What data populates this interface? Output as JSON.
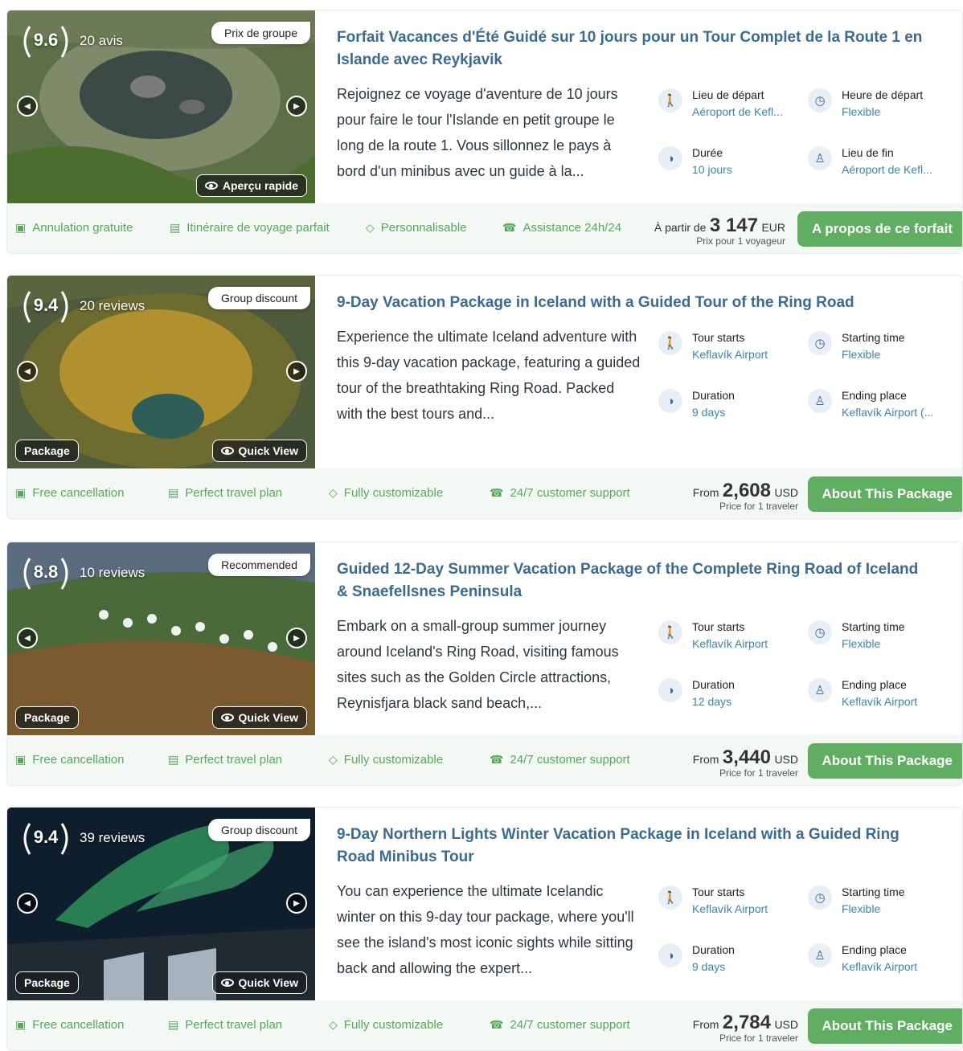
{
  "cards": [
    {
      "score": "9.6",
      "reviews": "20 avis",
      "badge": "Prix de groupe",
      "package_chip": "",
      "quickview": "Aperçu rapide",
      "title": "Forfait Vacances d'Été Guidé sur 10 jours pour un Tour Complet de la Route 1 en Islande avec Reykjavik",
      "description": "Rejoignez ce voyage d'aventure de 10 jours pour faire le tour l'Islande en petit groupe le long de la route 1. Vous sillonnez le pays à bord d'un minibus avec un guide à la...",
      "start_label": "Lieu de départ",
      "start_value": "Aéroport de Kefl...",
      "time_label": "Heure de départ",
      "time_value": "Flexible",
      "duration_label": "Durée",
      "duration_value": "10 jours",
      "end_label": "Lieu de fin",
      "end_value": "Aéroport de Kefl...",
      "features": [
        "Annulation gratuite",
        "Itinéraire de voyage parfait",
        "Personnalisable",
        "Assistance 24h/24"
      ],
      "price_from": "À partir de",
      "price": "3 147",
      "currency": "EUR",
      "price_note": "Prix pour 1 voyageur",
      "cta": "A propos de ce forfait"
    },
    {
      "score": "9.4",
      "reviews": "20 reviews",
      "badge": "Group discount",
      "package_chip": "Package",
      "quickview": "Quick View",
      "title": "9-Day Vacation Package in Iceland with a Guided Tour of the Ring Road",
      "description": "Experience the ultimate Iceland adventure with this 9-day vacation package, featuring a guided tour of the breathtaking Ring Road. Packed with the best tours and...",
      "start_label": "Tour starts",
      "start_value": "Keflavík Airport",
      "time_label": "Starting time",
      "time_value": "Flexible",
      "duration_label": "Duration",
      "duration_value": "9 days",
      "end_label": "Ending place",
      "end_value": "Keflavík Airport (...",
      "features": [
        "Free cancellation",
        "Perfect travel plan",
        "Fully customizable",
        "24/7 customer support"
      ],
      "price_from": "From",
      "price": "2,608",
      "currency": "USD",
      "price_note": "Price for 1 traveler",
      "cta": "About This Package"
    },
    {
      "score": "8.8",
      "reviews": "10 reviews",
      "badge": "Recommended",
      "package_chip": "Package",
      "quickview": "Quick View",
      "title": "Guided 12-Day Summer Vacation Package of the Complete Ring Road of Iceland & Snaefellsnes Peninsula",
      "description": "Embark on a small-group summer journey around Iceland's Ring Road, visiting famous sites such as the Golden Circle attractions, Reynisfjara black sand beach,...",
      "start_label": "Tour starts",
      "start_value": "Keflavík Airport",
      "time_label": "Starting time",
      "time_value": "Flexible",
      "duration_label": "Duration",
      "duration_value": "12 days",
      "end_label": "Ending place",
      "end_value": "Keflavík Airport",
      "features": [
        "Free cancellation",
        "Perfect travel plan",
        "Fully customizable",
        "24/7 customer support"
      ],
      "price_from": "From",
      "price": "3,440",
      "currency": "USD",
      "price_note": "Price for 1 traveler",
      "cta": "About This Package"
    },
    {
      "score": "9.4",
      "reviews": "39 reviews",
      "badge": "Group discount",
      "package_chip": "Package",
      "quickview": "Quick View",
      "title": "9-Day Northern Lights Winter Vacation Package in Iceland with a Guided Ring Road Minibus Tour",
      "description": "You can experience the ultimate Icelandic winter on this 9-day tour package, where you'll see the island's most iconic sights while sitting back and allowing the expert...",
      "start_label": "Tour starts",
      "start_value": "Keflavík Airport",
      "time_label": "Starting time",
      "time_value": "Flexible",
      "duration_label": "Duration",
      "duration_value": "9 days",
      "end_label": "Ending place",
      "end_value": "Keflavík Airport",
      "features": [
        "Free cancellation",
        "Perfect travel plan",
        "Fully customizable",
        "24/7 customer support"
      ],
      "price_from": "From",
      "price": "2,784",
      "currency": "USD",
      "price_note": "Price for 1 traveler",
      "cta": "About This Package"
    }
  ],
  "colors": {
    "title": "#3b6a92",
    "accent_green": "#5fae62",
    "feature_green": "#56a85a",
    "link_blue": "#3b83b6"
  },
  "icons": {
    "start": "hiker-icon",
    "time": "clock-icon",
    "duration": "duration-icon",
    "end": "person-icon"
  }
}
